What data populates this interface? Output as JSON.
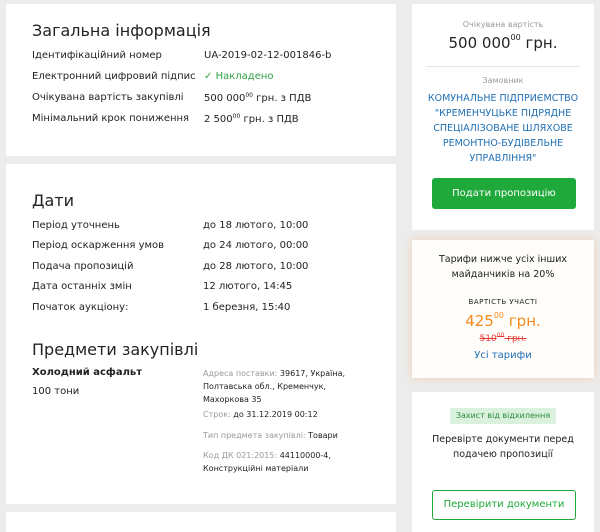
{
  "general": {
    "title": "Загальна інформація",
    "rows": [
      {
        "label": "Ідентифікаційний номер",
        "value": "UA-2019-02-12-001846-b"
      },
      {
        "label": "Електронний цифровий підпис",
        "value": "Накладено"
      },
      {
        "label": "Очікувана вартість закупівлі",
        "value_main": "500 000",
        "value_sup": "00",
        "value_tail": " грн. з ПДВ"
      },
      {
        "label": "Мінімальний крок пониження",
        "value_main": "2 500",
        "value_sup": "00",
        "value_tail": " грн. з ПДВ"
      }
    ]
  },
  "dates": {
    "title": "Дати",
    "rows": [
      {
        "label": "Період уточнень",
        "value": "до 18 лютого, 10:00"
      },
      {
        "label": "Період оскарження умов",
        "value": "до 24 лютого, 00:00"
      },
      {
        "label": "Подача пропозицій",
        "value": "до 28 лютого, 10:00"
      },
      {
        "label": "Дата останніх змін",
        "value": "12 лютого, 14:45"
      },
      {
        "label": "Початок аукціону:",
        "value": "1 березня, 15:40"
      }
    ]
  },
  "items": {
    "title": "Предмети закупівлі",
    "name": "Холодний асфальт",
    "quantity": "100 тони",
    "address_label": "Адреса поставки:",
    "address_value1": "39617, Україна,",
    "address_value2": "Полтавська обл., Кременчук,",
    "address_value3": "Махоркова 35",
    "term_label": "Строк:",
    "term_value": "до 31.12.2019 00:12",
    "type_label": "Тип предмета закупівлі:",
    "type_value": "Товари",
    "code_label": "Код ДК 021:2015:",
    "code_value1": "44110000-4,",
    "code_value2": "Конструкційні матеріали"
  },
  "sidebar": {
    "expected_label": "Очікувана вартість",
    "expected_main": "500 000",
    "expected_sup": "00",
    "expected_tail": " грн.",
    "customer_label": "Замовник",
    "customer_lines": [
      "КОМУНАЛЬНЕ ПІДПРИЄМСТВО",
      "\"КРЕМЕНЧУЦЬКЕ ПІДРЯДНЕ",
      "СПЕЦІАЛІЗОВАНЕ ШЛЯХОВЕ",
      "РЕМОНТНО-БУДІВЕЛЬНЕ",
      "УПРАВЛІННЯ\""
    ],
    "submit_button": "Подати пропозицію",
    "tariff_text1": "Тарифи нижче усіх інших",
    "tariff_text2": "майданчиків на 20%",
    "participation_label": "ВАРТІСТЬ УЧАСТІ",
    "price_main": "425",
    "price_sup": "00",
    "price_tail": " грн.",
    "old_price_main": "510",
    "old_price_sup": "00",
    "old_price_tail": " грн.",
    "all_tariffs": "Усі тарифи",
    "protect_badge": "Захист від відхилення",
    "check_text1": "Перевірте документи перед",
    "check_text2": "подачею пропозиції",
    "check_button": "Перевірити документи"
  }
}
